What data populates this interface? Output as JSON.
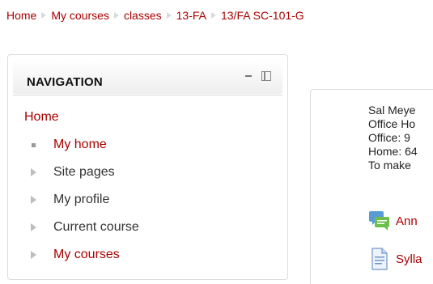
{
  "breadcrumb": [
    "Home",
    "My courses",
    "classes",
    "13-FA",
    "13/FA SC-101-G"
  ],
  "navigation": {
    "title": "NAVIGATION",
    "root": "Home",
    "items": [
      {
        "label": "My home",
        "marker": "bullet-icon",
        "link": true
      },
      {
        "label": "Site pages",
        "marker": "expand-triangle-icon",
        "link": false
      },
      {
        "label": "My profile",
        "marker": "expand-triangle-icon",
        "link": false
      },
      {
        "label": "Current course",
        "marker": "expand-triangle-icon",
        "link": false
      },
      {
        "label": "My courses",
        "marker": "expand-triangle-icon",
        "link": true
      }
    ]
  },
  "content": {
    "info_lines": [
      "Sal Meye",
      "Office Ho",
      "Office: 9",
      "Home: 64",
      "To make"
    ],
    "resources": [
      {
        "label": "Ann",
        "icon": "forum-icon"
      },
      {
        "label": "Sylla",
        "icon": "document-icon"
      }
    ]
  },
  "colors": {
    "link": "#a90000",
    "separator": "#d9d9d9",
    "border": "#dcdcdc"
  }
}
